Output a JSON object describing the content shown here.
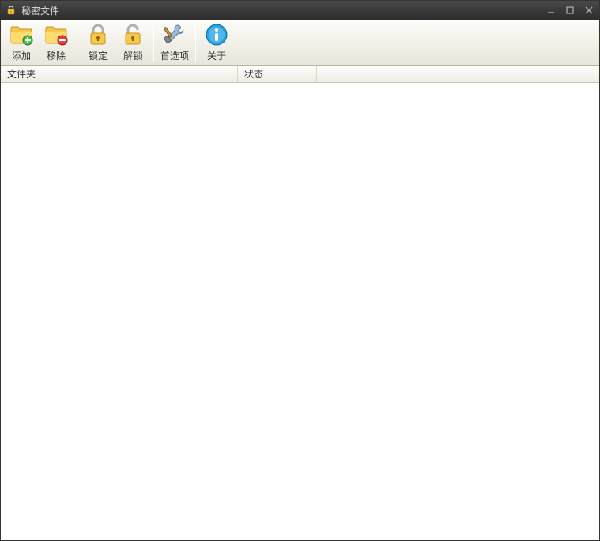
{
  "title": "秘密文件",
  "toolbar": {
    "add": "添加",
    "remove": "移除",
    "lock": "锁定",
    "unlock": "解锁",
    "prefs": "首选项",
    "about": "关于"
  },
  "columns": {
    "folder": "文件夹",
    "status": "状态"
  }
}
